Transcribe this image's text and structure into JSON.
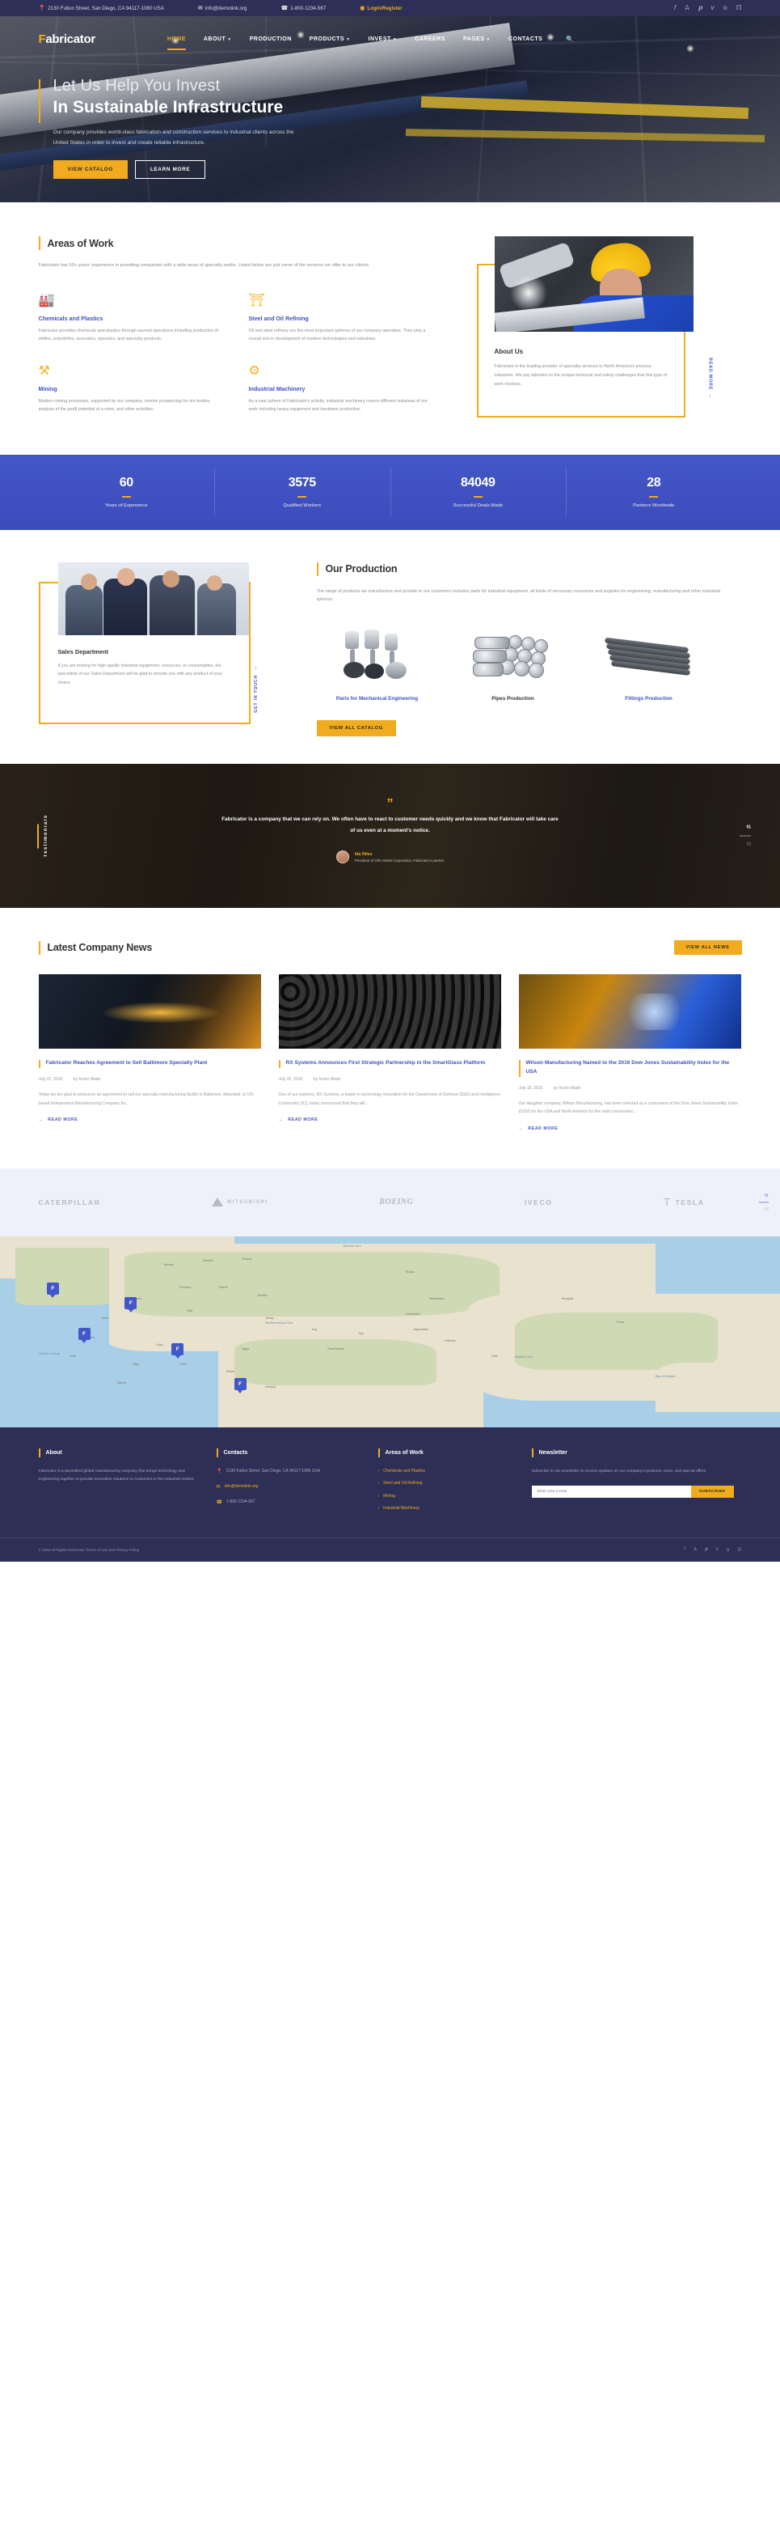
{
  "topbar": {
    "address": "2130 Fulton Street, San Diego, CA 94117-1080 USA",
    "email": "info@demolink.org",
    "phone": "1-800-1234-567",
    "login": "Login/Register",
    "socials": [
      "f",
      "t",
      "p",
      "v",
      "g",
      "r"
    ]
  },
  "nav": {
    "logo_first": "F",
    "logo_rest": "abricator",
    "items": [
      {
        "label": "HOME",
        "active": true,
        "caret": false
      },
      {
        "label": "ABOUT",
        "active": false,
        "caret": true
      },
      {
        "label": "PRODUCTION",
        "active": false,
        "caret": false
      },
      {
        "label": "PRODUCTS",
        "active": false,
        "caret": true
      },
      {
        "label": "INVEST",
        "active": false,
        "caret": true
      },
      {
        "label": "CAREERS",
        "active": false,
        "caret": false
      },
      {
        "label": "PAGES",
        "active": false,
        "caret": true
      },
      {
        "label": "CONTACTS",
        "active": false,
        "caret": false
      }
    ],
    "search_icon": "search-icon"
  },
  "hero": {
    "line1": "Let Us Help You Invest",
    "line2": "In Sustainable Infrastructure",
    "paragraph": "Our company provides world-class fabrication and construction services to industrial clients across the United States in order to invest and create reliable infrastructure.",
    "btn_primary": "VIEW CATALOG",
    "btn_secondary": "LEARN MORE"
  },
  "areas": {
    "title": "Areas of Work",
    "intro": "Fabricator has 50+ years' experience in providing companies with a wide array of specialty works. Listed below are just some of the services we offer to our clients.",
    "items": [
      {
        "icon": "factory-icon",
        "title": "Chemicals and Plastics",
        "text": "Fabricator provides chemicals and plastics through several operations including production of olefins, polyolefins, aromatics, styrenics, and specialty products."
      },
      {
        "icon": "oil-barrel-icon",
        "title": "Steel and Oil Refining",
        "text": "Oil and steel refinery are the most important spheres of our company operation. They play a crucial role in development of modern technologies and industries."
      },
      {
        "icon": "pickaxe-icon",
        "title": "Mining",
        "text": "Modern mining processes, supported by our company, involve prospecting for ore bodies, analysis of the profit potential of a mine, and other activities."
      },
      {
        "icon": "gear-icon",
        "title": "Industrial Machinery",
        "text": "As a vast sphere of Fabricator's activity, industrial machinery covers different subareas of our work including heavy equipment and hardware production."
      }
    ]
  },
  "about": {
    "title": "About Us",
    "text": "Fabricator is the leading provider of specialty services to North America's process industries. We pay attention to the unique technical and safety challenges that this type of work involves.",
    "read_more": "READ MORE",
    "image_alt": "worker-with-yellow-helmet-photo"
  },
  "stats": [
    {
      "number": "60",
      "label": "Years of Experience"
    },
    {
      "number": "3575",
      "label": "Qualified Workers"
    },
    {
      "number": "84049",
      "label": "Successful Deals Made"
    },
    {
      "number": "28",
      "label": "Partners Worldwide"
    }
  ],
  "sales": {
    "title": "Sales Department",
    "text": "If you are looking for high-qaulity industrial equipment, resources, or consumables, the specialists of our Sales Department will be glad to provide you with any product of your choice.",
    "get_in_touch": "GET IN TOUCH",
    "image_alt": "business-team-photo"
  },
  "production": {
    "title": "Our Production",
    "intro": "The range of products we manufacture and provide to our customers includes parts for industrial equipment, all kinds of necessary resources and supplies for engineering, manufacturing and other industrial spheres.",
    "items": [
      {
        "label": "Parts for Mechanical Engineering",
        "icon": "pistons-image",
        "highlight": true
      },
      {
        "label": "Pipes Production",
        "icon": "pipes-image",
        "highlight": false
      },
      {
        "label": "Fittings Production",
        "icon": "fittings-image",
        "highlight": true
      }
    ],
    "button": "VIEW ALL CATALOG"
  },
  "testimonials": {
    "side_label": "Testimonials",
    "quote_mark": "”",
    "quote": "Fabricator is a company that we can rely on.  We often have to react to customer needs quickly and we know that Fabricator will take care of us even at a moment's notice.",
    "author": "Ida Niles",
    "role": "President of Ohio Metal Corporation, Fabricator's partner",
    "counter_current": "01",
    "counter_total": "03"
  },
  "news": {
    "title": "Latest Company News",
    "view_all": "VIEW ALL NEWS",
    "read_more": "READ MORE",
    "items": [
      {
        "title": "Fabricator Reaches Agreement to Sell Baltimore Specialty Plant",
        "date": "July 22, 2016",
        "author": "by Kevin Wade",
        "excerpt": "Today we are glad to announce an agreement to sell our specialty manufacturing facility in Baltimore, Maryland, to US-based Independent Manufacturing Company for...",
        "image": "welding-sparks-photo"
      },
      {
        "title": "RX Systems Announces First Strategic Partnership in the SmartGlass Platform",
        "date": "July 20, 2016",
        "author": "by Kevin Wade",
        "excerpt": "One of our partners, RX Systems, a leader in technology innovation for the Department of Defense (DoD) and Intelligence Community (IC), today announced that they will...",
        "image": "steel-pipes-photo"
      },
      {
        "title": "Wilson Manufacturing Named to the 2016 Dow Jones Sustainability Index for the USA",
        "date": "July 18, 2016",
        "author": "by Kevin Wade",
        "excerpt": "Our daughter company, Wilson Manufacturing, has been selected as a component of the Dow Jones Sustainability Index (DJSI) for the USA and North America for the sixth consecutive...",
        "image": "welder-at-work-photo"
      }
    ]
  },
  "brands": {
    "items": [
      "CATERPILLAR",
      "MITSUBISHI",
      "BOEING",
      "IVECO",
      "TESLA"
    ],
    "counter_current": "01",
    "counter_total": "02"
  },
  "map": {
    "pins": [
      "F",
      "F",
      "F",
      "F",
      "F"
    ],
    "labels": [
      "Norway",
      "Sweden",
      "Finland",
      "Russia",
      "Ukraine",
      "Poland",
      "Germany",
      "France",
      "Spain",
      "Italy",
      "Turkey",
      "Iraq",
      "Iran",
      "Kazakhstan",
      "Mongolia",
      "China",
      "India",
      "Egypt",
      "Algeria",
      "Libya",
      "Sudan",
      "Niger",
      "Chad",
      "Mali",
      "Afghanistan",
      "Pakistan",
      "Saudi Arabia",
      "Uzbekistan",
      "Nigeria",
      "Ethiopia"
    ],
    "seas": [
      "Atlantic Ocean",
      "Mediterranean Sea",
      "Arabian Sea",
      "Bay of Bengal",
      "Barents Sea"
    ]
  },
  "footer": {
    "about": {
      "heading": "About",
      "text": "Fabricator is a diversified global manufacturing company that brings technology and engineering together to provide innovative solutions to customers in the industrial market."
    },
    "contacts": {
      "heading": "Contacts",
      "address": "2130 Fulton Street, San Diego, CA 94117-1080 USA",
      "email": "info@demolink.org",
      "phone": "1-800-1234-567"
    },
    "areas": {
      "heading": "Areas of Work",
      "links": [
        "Chemicals and Plastics",
        "Steel and Oil Refining",
        "Mining",
        "Industrial Machinery"
      ]
    },
    "newsletter": {
      "heading": "Newsletter",
      "text": "Subscribe to our newsletter to receive updates on our company's products, news, and special offers.",
      "placeholder": "Enter your e-mail",
      "button": "SUBSCRIBE"
    },
    "copyright": "© 2016 All Rights Reserved. Terms of Use and Privacy Policy.",
    "socials": [
      "f",
      "t",
      "p",
      "v",
      "g",
      "r"
    ]
  },
  "colors": {
    "navy": "#2e2f56",
    "yellow": "#f0ab1e",
    "blue": "#3f51c4",
    "stats_blue": "#4457c8"
  }
}
